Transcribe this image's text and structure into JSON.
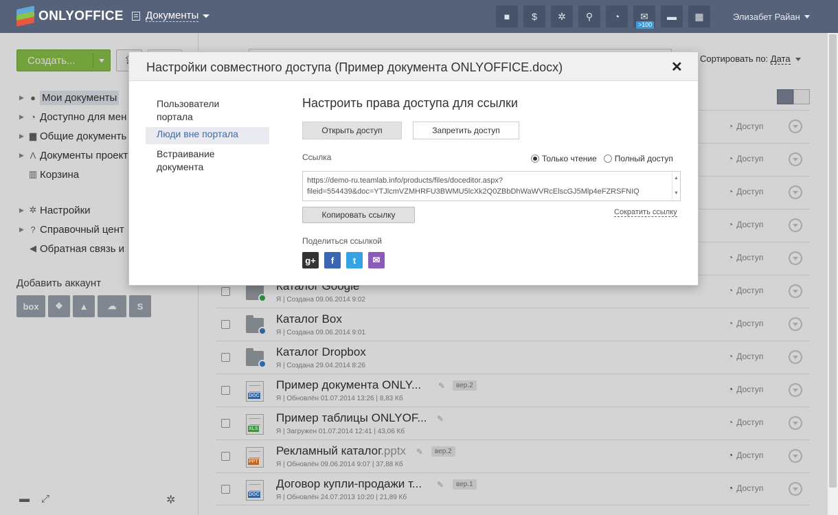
{
  "topbar": {
    "logo": "ONLYOFFICE",
    "module": "Документы",
    "user": "Элизабет Райан",
    "mail_badge": ">100",
    "icons": [
      "video-icon",
      "dollar-icon",
      "gear-icon",
      "search-icon",
      "feed-icon",
      "mail-icon",
      "chat-icon",
      "calendar-icon"
    ]
  },
  "left": {
    "create": "Создать...",
    "nav": [
      {
        "label": "Мои документы",
        "icon": "user-icon"
      },
      {
        "label": "Доступно для мен",
        "icon": "share-icon"
      },
      {
        "label": "Общие документь",
        "icon": "briefcase-icon"
      },
      {
        "label": "Документы проект",
        "icon": "project-icon"
      },
      {
        "label": "Корзина",
        "icon": "trash-icon"
      }
    ],
    "nav2": [
      {
        "label": "Настройки",
        "icon": "gear-icon"
      },
      {
        "label": "Справочный цент",
        "icon": "help-icon"
      },
      {
        "label": "Обратная связь и",
        "icon": "megaphone-icon"
      }
    ],
    "add_account": "Добавить аккаунт",
    "accounts": [
      "box",
      "dropbox",
      "google-drive",
      "onedrive",
      "sharepoint"
    ]
  },
  "sort": {
    "label": "Сортировать по:",
    "value": "Дата"
  },
  "files": [
    {
      "name": "Каталог Google",
      "ext": "",
      "meta": "Я | Создана 09.06.2014 9:02",
      "type": "folder",
      "share": "Доступ",
      "ver": "",
      "shared": false
    },
    {
      "name": "Каталог Box",
      "ext": "",
      "meta": "Я | Создана 09.06.2014 9:01",
      "type": "folder",
      "share": "Доступ",
      "ver": "",
      "shared": false
    },
    {
      "name": "Каталог Dropbox",
      "ext": "",
      "meta": "Я | Создана 29.04.2014 8:26",
      "type": "folder",
      "share": "Доступ",
      "ver": "",
      "shared": false
    },
    {
      "name": "Пример документа ONLY...",
      "ext": "",
      "meta": "Я | Обновлён 01.07.2014 13:26 | 8,83 Кб",
      "type": "doc",
      "share": "Доступ",
      "ver": "вер.2",
      "shared": true
    },
    {
      "name": "Пример таблицы ONLYOF...",
      "ext": "",
      "meta": "Я | Загружен 01.07.2014 12:41 | 43,06 Кб",
      "type": "xls",
      "share": "Доступ",
      "ver": "",
      "shared": false
    },
    {
      "name": "Рекламный каталог",
      "ext": ".pptx",
      "meta": "Я | Обновлён 09.06.2014 9:07 | 37,88 Кб",
      "type": "ppt",
      "share": "Доступ",
      "ver": "вер.2",
      "shared": true
    },
    {
      "name": "Договор купли-продажи т...",
      "ext": "",
      "meta": "Я | Обновлён 24.07.2013 10:20 | 21,89 Кб",
      "type": "doc",
      "share": "Доступ",
      "ver": "вер.1",
      "shared": true
    }
  ],
  "hidden_row_share": "Доступ",
  "dialog": {
    "title": "Настройки совместного доступа (Пример документа ONLYOFFICE.docx)",
    "menu": [
      "Пользователи портала",
      "Люди вне портала",
      "Встраивание документа"
    ],
    "section_title": "Настроить права доступа для ссылки",
    "open_access": "Открыть доступ",
    "deny_access": "Запретить доступ",
    "link_label": "Ссылка",
    "read_only": "Только чтение",
    "full_access": "Полный доступ",
    "link_line1": "https://demo-ru.teamlab.info/products/files/doceditor.aspx?",
    "link_line2": "fileid=554439&doc=YTJlcmVZMHRFU3BWMU5lcXk2Q0ZBbDhWaWVRcElscGJ5Mlp4eFZRSFNIQ",
    "copy_link": "Копировать ссылку",
    "shorten_link": "Сократить ссылку",
    "share_label": "Поделиться ссылкой",
    "social": [
      "g+",
      "f",
      "t",
      "✉"
    ]
  }
}
